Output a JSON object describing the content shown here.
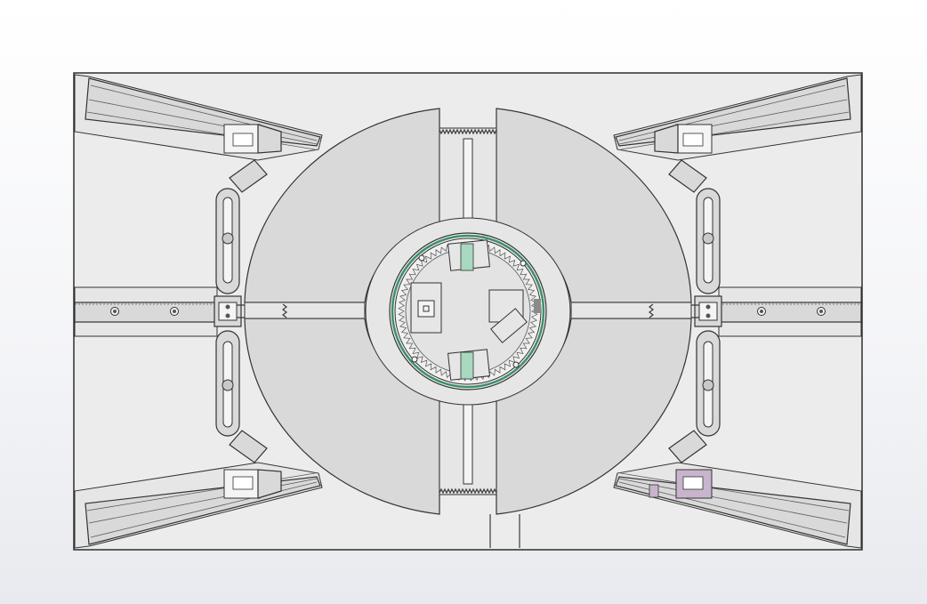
{
  "viewport": {
    "background_top": "#ffffff",
    "background_bottom": "#e9eaef"
  },
  "model": {
    "frame_fill": "#ececec",
    "part_fill": "#d9d9d9",
    "edge_color": "#333333",
    "bearing_ring_color": "#3f8f6b",
    "gear_tooth_count": 72,
    "highlight_color": "#a8d8c0",
    "accent_color": "#c8b4cc"
  }
}
